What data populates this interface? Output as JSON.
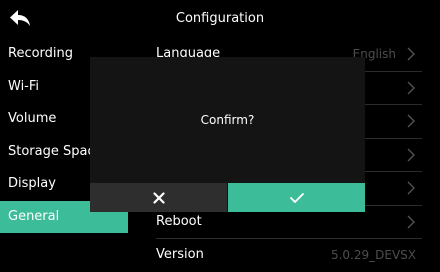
{
  "header": {
    "title": "Configuration"
  },
  "sidebar": {
    "items": [
      {
        "label": "Recording"
      },
      {
        "label": "Wi-Fi"
      },
      {
        "label": "Volume"
      },
      {
        "label": "Storage Space"
      },
      {
        "label": "Display"
      },
      {
        "label": "General",
        "active": true
      }
    ]
  },
  "settings": {
    "rows": [
      {
        "label": "Language",
        "value": "English"
      },
      {
        "label": "",
        "value": ""
      },
      {
        "label": "",
        "value": ""
      },
      {
        "label": "",
        "value": ""
      },
      {
        "label": "",
        "value": ""
      },
      {
        "label": "Reboot",
        "value": ""
      },
      {
        "label": "Version",
        "value": "5.0.29_DEVSX"
      }
    ]
  },
  "dialog": {
    "message": "Confirm?"
  },
  "colors": {
    "accent": "#3dbc9a",
    "background": "#000000",
    "dialog": "#141414",
    "cancel": "#2e2e2e",
    "muted": "#4d4d4d"
  },
  "icons": {
    "back": "back-arrow-icon",
    "chevron": "chevron-right-icon",
    "cancel": "x-icon",
    "ok": "check-icon"
  }
}
